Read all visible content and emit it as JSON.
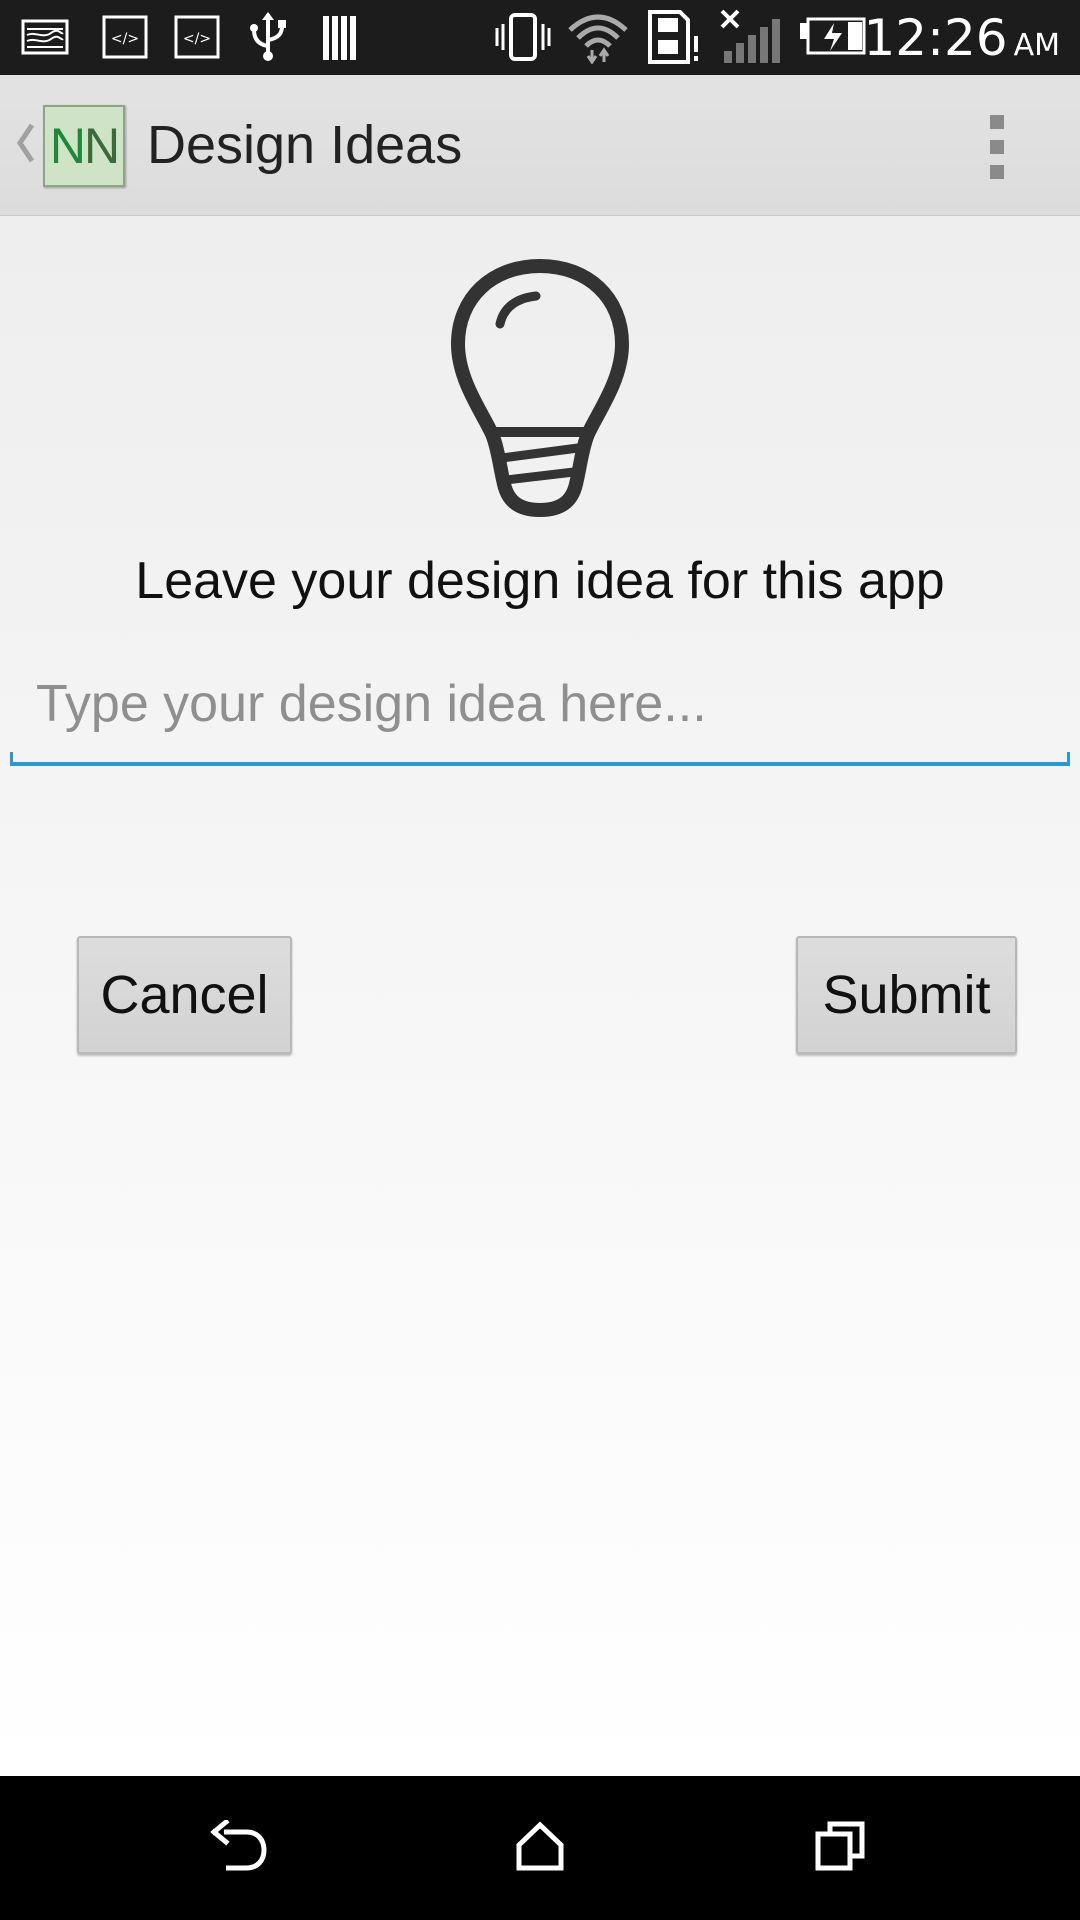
{
  "status_bar": {
    "time": "12:26",
    "ampm": "AM",
    "icons": [
      "image-notification-icon",
      "code-notification-icon",
      "code-notification-icon",
      "usb-icon",
      "storage-bars-icon",
      "vibrate-icon",
      "wifi-icon",
      "sd-card-alert-icon",
      "no-signal-icon",
      "battery-charging-icon"
    ]
  },
  "action_bar": {
    "logo_letters": [
      "N",
      "N"
    ],
    "title": "Design Ideas"
  },
  "main": {
    "prompt": "Leave your design idea for this app",
    "idea_input": {
      "value": "",
      "placeholder": "Type your design idea here..."
    },
    "cancel_label": "Cancel",
    "submit_label": "Submit"
  },
  "colors": {
    "accent": "#2a9ad6",
    "status_bar_bg": "#1c1c1c",
    "action_bar_bg": "#dedede",
    "nav_bar_bg": "#000000"
  }
}
